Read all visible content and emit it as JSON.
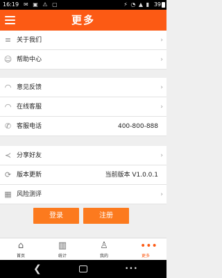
{
  "statusbar": {
    "time": "16:19",
    "battery": "39"
  },
  "appbar": {
    "title": "更多"
  },
  "menu": {
    "about": "关于我们",
    "help": "帮助中心",
    "feedback": "意见反馈",
    "online_service": "在线客服",
    "phone_label": "客服电话",
    "phone_value": "400-800-888",
    "share": "分享好友",
    "version_label": "版本更新",
    "version_value": "当前版本 V1.0.0.1",
    "risk": "风险测评"
  },
  "buttons": {
    "login": "登录",
    "register": "注册"
  },
  "tabs": {
    "home": "首页",
    "stats": "统计",
    "mine": "我的",
    "more": "更多",
    "active": "more"
  },
  "colors": {
    "brand": "#fc5a14",
    "button": "#fc7a1e"
  }
}
